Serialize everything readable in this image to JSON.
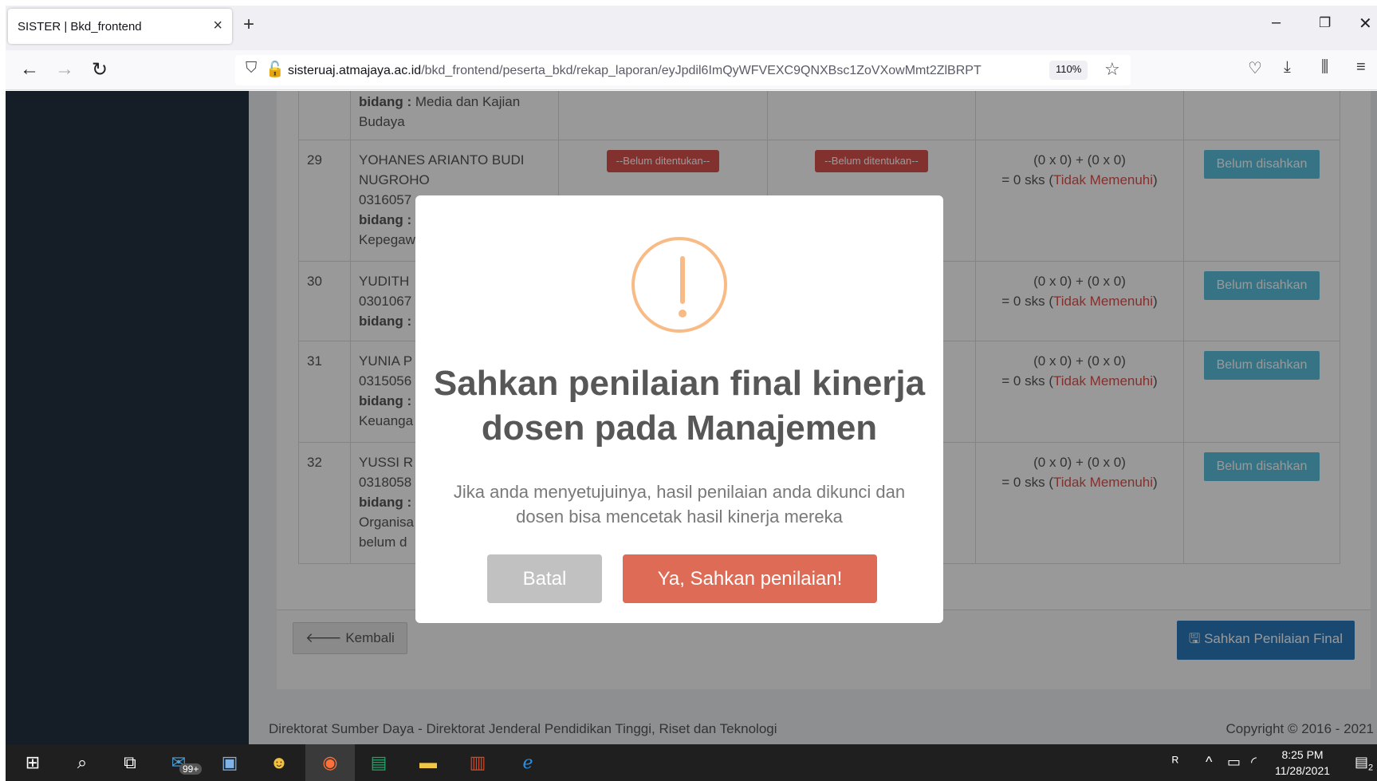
{
  "browser": {
    "tab_title": "SISTER | Bkd_frontend",
    "tab_close": "×",
    "new_tab": "+",
    "url_domain": "sisteruaj.atmajaya.ac.id",
    "url_path": "/bkd_frontend/peserta_bkd/rekap_laporan/eyJpdil6ImQyWFVEXC9QNXBsc1ZoVXowMmt2ZlBRPT",
    "zoom": "110%",
    "window_controls": [
      "–",
      "❐",
      "✕"
    ]
  },
  "table": {
    "rows": [
      {
        "no": "",
        "lines": [
          "bidang : Media dan Kajian",
          "Budaya"
        ],
        "bold_prefix": "bidang :",
        "jenis1": "",
        "jenis2": "",
        "sks1": "",
        "sks2": "",
        "status": ""
      },
      {
        "no": "29",
        "name1": "YOHANES ARIANTO BUDI",
        "name2": "NUGROHO",
        "nip": "0316057",
        "bidang": "bidang :",
        "extra": "Kepegaw",
        "jenis1": "--Belum ditentukan--",
        "jenis2": "--Belum ditentukan--",
        "sks1": "(0 x 0) + (0 x 0)",
        "sks2": "= 0 sks (",
        "memenuhi": "Tidak Memenuhi",
        "close": ")",
        "status": "Belum disahkan"
      },
      {
        "no": "30",
        "name1": "YUDITH",
        "nip": "0301067",
        "bidang": "bidang :",
        "sks1": "(0 x 0) + (0 x 0)",
        "sks2": "= 0 sks (",
        "memenuhi": "Tidak Memenuhi",
        "close": ")",
        "status": "Belum disahkan"
      },
      {
        "no": "31",
        "name1": "YUNIA P",
        "nip": "0315056",
        "bidang": "bidang :",
        "extra": "Keuanga",
        "sks1": "(0 x 0) + (0 x 0)",
        "sks2": "= 0 sks (",
        "memenuhi": "Tidak Memenuhi",
        "close": ")",
        "status": "Belum disahkan"
      },
      {
        "no": "32",
        "name1": "YUSSI R",
        "nip": "0318058",
        "bidang": "bidang :",
        "extra": "Organisa",
        "extra2": "belum d",
        "sks1": "(0 x 0) + (0 x 0)",
        "sks2": "= 0 sks (",
        "memenuhi": "Tidak Memenuhi",
        "close": ")",
        "status": "Belum disahkan"
      }
    ],
    "first_row_bidang_value": "Media dan Kajian",
    "first_row_extra": "Budaya"
  },
  "actions": {
    "back": "Kembali",
    "back_icon": "arrow-left-icon",
    "final": "Sahkan Penilaian Final",
    "final_icon": "save-icon"
  },
  "footer": {
    "left": "Direktorat Sumber Daya - Direktorat Jenderal Pendidikan Tinggi, Riset dan Teknologi",
    "right": "Copyright © 2016 - 2021"
  },
  "modal": {
    "icon": "warning-icon",
    "title": "Sahkan penilaian final kinerja dosen pada Manajemen",
    "text": "Jika anda menyetujuinya, hasil penilaian anda dikunci dan dosen bisa mencetak hasil kinerja mereka",
    "cancel": "Batal",
    "confirm": "Ya, Sahkan penilaian!"
  },
  "taskbar": {
    "badge": "99+",
    "time": "8:25 PM",
    "date": "11/28/2021",
    "notif_count": "2"
  },
  "colors": {
    "sidebar": "#243240",
    "danger": "#d9534f",
    "info": "#5bc0de",
    "primary": "#2a78bd",
    "confirm": "#dd6b55",
    "warning": "#f8bb86"
  }
}
